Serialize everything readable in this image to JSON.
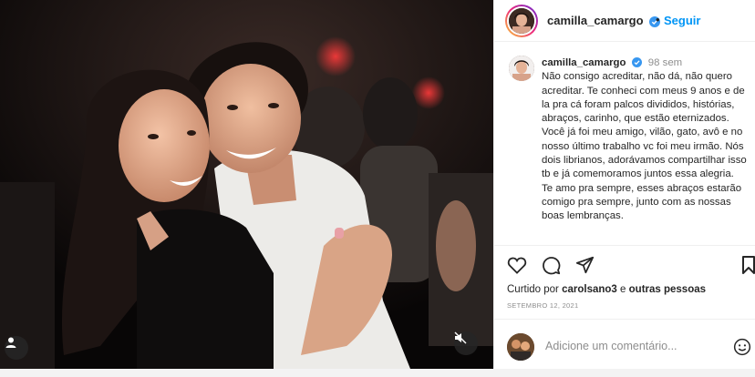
{
  "post": {
    "username": "camilla_camargo",
    "follow_label": "Seguir",
    "header_separator": "•"
  },
  "caption": {
    "username": "camilla_camargo",
    "time": "98 sem",
    "text": "Não consigo acreditar, não dá, não quero acreditar. Te conheci com meus 9 anos e de la pra cá foram palcos divididos, histórias, abraços, carinho, que estão eternizados. Você já foi meu amigo, vilão, gato, avô e no nosso último trabalho vc foi meu irmão. Nós dois librianos, adorávamos compartilhar isso tb e já comemoramos juntos essa alegria. Te amo pra sempre, esses abraços estarão comigo pra sempre, junto com as nossas boas lembranças."
  },
  "likes": {
    "prefix": "Curtido por",
    "user": "carolsano3",
    "connector": "e",
    "others": "outras pessoas"
  },
  "date": "SETEMBRO 12, 2021",
  "add_comment": {
    "placeholder": "Adicione um comentário..."
  },
  "icons": {
    "verified": "verified-badge-icon",
    "like": "heart-icon",
    "comment": "comment-icon",
    "share": "paper-plane-icon",
    "save": "bookmark-icon",
    "emoji": "smiley-icon",
    "tag": "user-tag-icon",
    "mute": "muted-speaker-icon"
  },
  "colors": {
    "link": "#0095f6",
    "verified": "#3897f0",
    "text": "#262626",
    "muted": "#8e8e8e"
  }
}
